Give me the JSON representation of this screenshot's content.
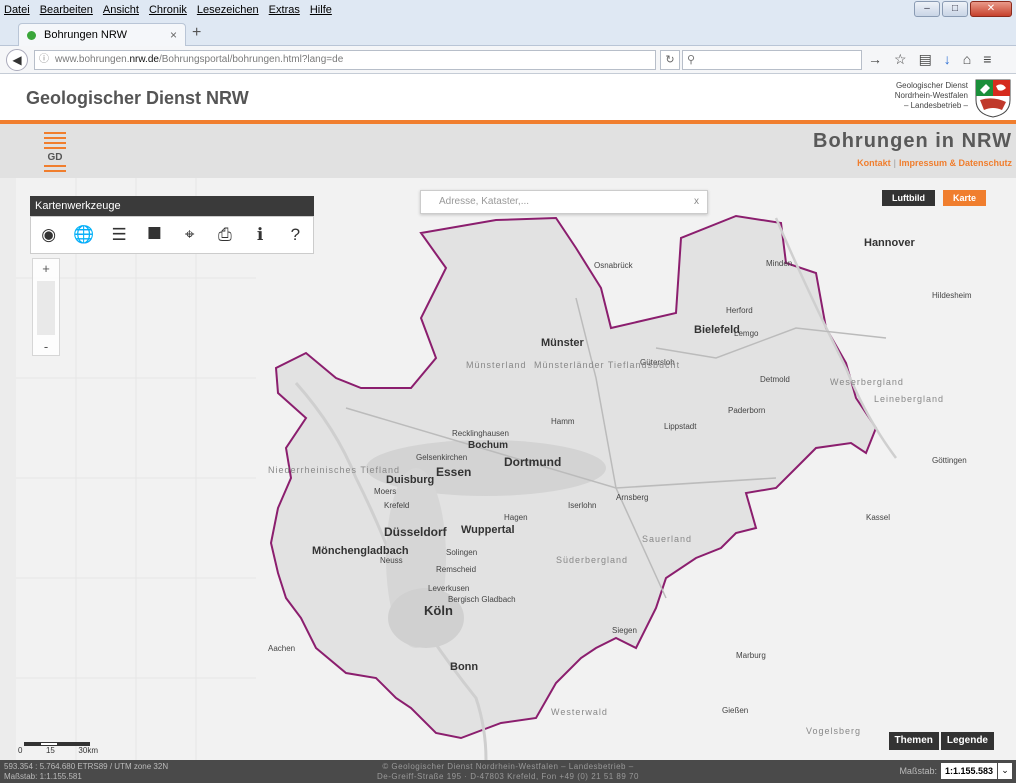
{
  "browser": {
    "menu": [
      "Datei",
      "Bearbeiten",
      "Ansicht",
      "Chronik",
      "Lesezeichen",
      "Extras",
      "Hilfe"
    ],
    "tab_title": "Bohrungen NRW",
    "tab_close": "×",
    "new_tab": "+",
    "url_host": "www.bohrungen.",
    "url_domain": "nrw.de",
    "url_path": "/Bohrungsportal/bohrungen.html?lang=de",
    "search_icon": "search-icon"
  },
  "site": {
    "title": "Geologischer Dienst NRW",
    "brand_lines": [
      "Geologischer Dienst",
      "Nordrhein-Westfalen",
      "– Landesbetrieb –"
    ],
    "logo_text": "GD",
    "app_title": "Bohrungen in NRW",
    "links": [
      "Kontakt",
      "Impressum & Datenschutz"
    ]
  },
  "map": {
    "address_placeholder": "Adresse, Kataster,...",
    "address_clear": "x",
    "toolbox_title": "Kartenwerkzeuge",
    "tools": [
      "nrw-outline-icon",
      "globe-icon",
      "layers-add-icon",
      "select-cursor-icon",
      "locate-icon",
      "print-icon",
      "info-icon",
      "help-icon"
    ],
    "zoom_in": "+",
    "zoom_out": "-",
    "layers": {
      "aerial": "Luftbild",
      "map": "Karte",
      "active": "Karte"
    },
    "buttons": {
      "themes": "Themen",
      "legend": "Legende"
    },
    "scalebar": [
      "0",
      "15",
      "30km"
    ],
    "places_large": [
      "Münster",
      "Bielefeld",
      "Essen",
      "Dortmund",
      "Bochum",
      "Duisburg",
      "Düsseldorf",
      "Wuppertal",
      "Köln",
      "Bonn",
      "Mönchengladbach",
      "Hannover"
    ],
    "places_medium": [
      "Osnabrück",
      "Paderborn",
      "Hamm",
      "Aachen",
      "Siegen",
      "Leverkusen",
      "Hagen",
      "Solingen",
      "Remscheid",
      "Gütersloh",
      "Recklinghausen",
      "Gelsenkirchen",
      "Krefeld",
      "Neuss",
      "Moers",
      "Bergisch Gladbach",
      "Detmold",
      "Lippstadt",
      "Arnsberg",
      "Iserlohn",
      "Göttingen",
      "Kassel",
      "Hildesheim",
      "Marburg",
      "Gießen",
      "Minden",
      "Herford",
      "Lemgo"
    ],
    "regions": [
      "Münsterland",
      "Münsterländer Tieflandsbucht",
      "Niederrheinisches Tiefland",
      "Sauerland",
      "Süderbergland",
      "Westerwald",
      "Vogelsberg",
      "Weserbergland",
      "Leinebergland"
    ]
  },
  "status": {
    "coords": "593.354 : 5.764.680   ETRS89 / UTM zone 32N",
    "scale_text": "Maßstab: 1:1.155.581",
    "copyright_1": "© Geologischer Dienst Nordrhein-Westfalen – Landesbetrieb –",
    "copyright_2": "De-Greiff-Straße 195 · D-47803 Krefeld, Fon +49 (0) 21 51 89 70",
    "scale_label": "Maßstab:",
    "scale_value": "1:1.155.583"
  },
  "colors": {
    "accent": "#f07e2e",
    "border": "#8b1e6e",
    "dark": "#3a3a3a"
  }
}
